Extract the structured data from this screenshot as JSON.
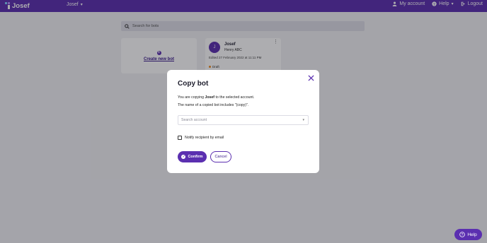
{
  "topbar": {
    "logo_text": "Josef",
    "brand_menu_label": "Josef",
    "my_account_label": "My account",
    "help_label": "Help",
    "logout_label": "Logout",
    "color": "#5b2fb0"
  },
  "search": {
    "placeholder": "Search for bots"
  },
  "create_card": {
    "label": "Create new bot"
  },
  "bot_card": {
    "avatar_letter": "J",
    "name": "Josef",
    "owner": "Henry ABC",
    "edited": "Edited 27 February 2022 at 11:11 PM",
    "status": "Draft"
  },
  "modal": {
    "title": "Copy bot",
    "text_prefix": "You are copying ",
    "bot_name": "Josef",
    "text_suffix": " to the selected account.",
    "note": "The name of a copied bot includes \"(copy)\".",
    "account_placeholder": "Search account",
    "notify_label": "Notify recipient by email",
    "confirm_label": "Confirm",
    "cancel_label": "Cancel"
  },
  "help_fab": {
    "label": "Help"
  }
}
